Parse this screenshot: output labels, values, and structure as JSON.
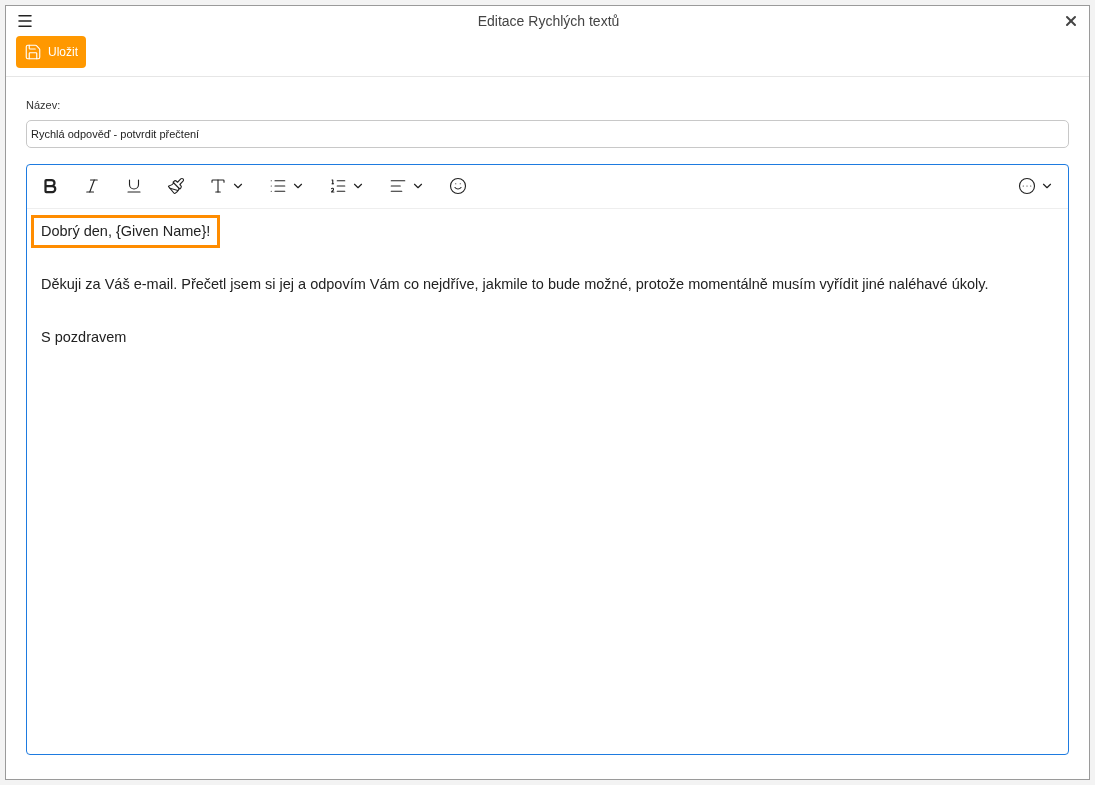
{
  "window": {
    "title": "Editace Rychlých textů"
  },
  "toolbar": {
    "save_button": "Uložit"
  },
  "name_field": {
    "label": "Název:",
    "value": "Rychlá odpověď - potvrdit přečtení"
  },
  "editor": {
    "focused": true,
    "paragraphs": [
      {
        "text": "Dobrý den, {Given Name}!",
        "highlighted": true
      },
      {
        "text": "Děkuji za Váš e-mail. Přečetl jsem si jej a odpovím Vám co nejdříve, jakmile to bude možné, protože momentálně musím vyřídit jiné naléhavé úkoly.",
        "highlighted": false
      },
      {
        "text": "S pozdravem",
        "highlighted": false
      }
    ]
  }
}
